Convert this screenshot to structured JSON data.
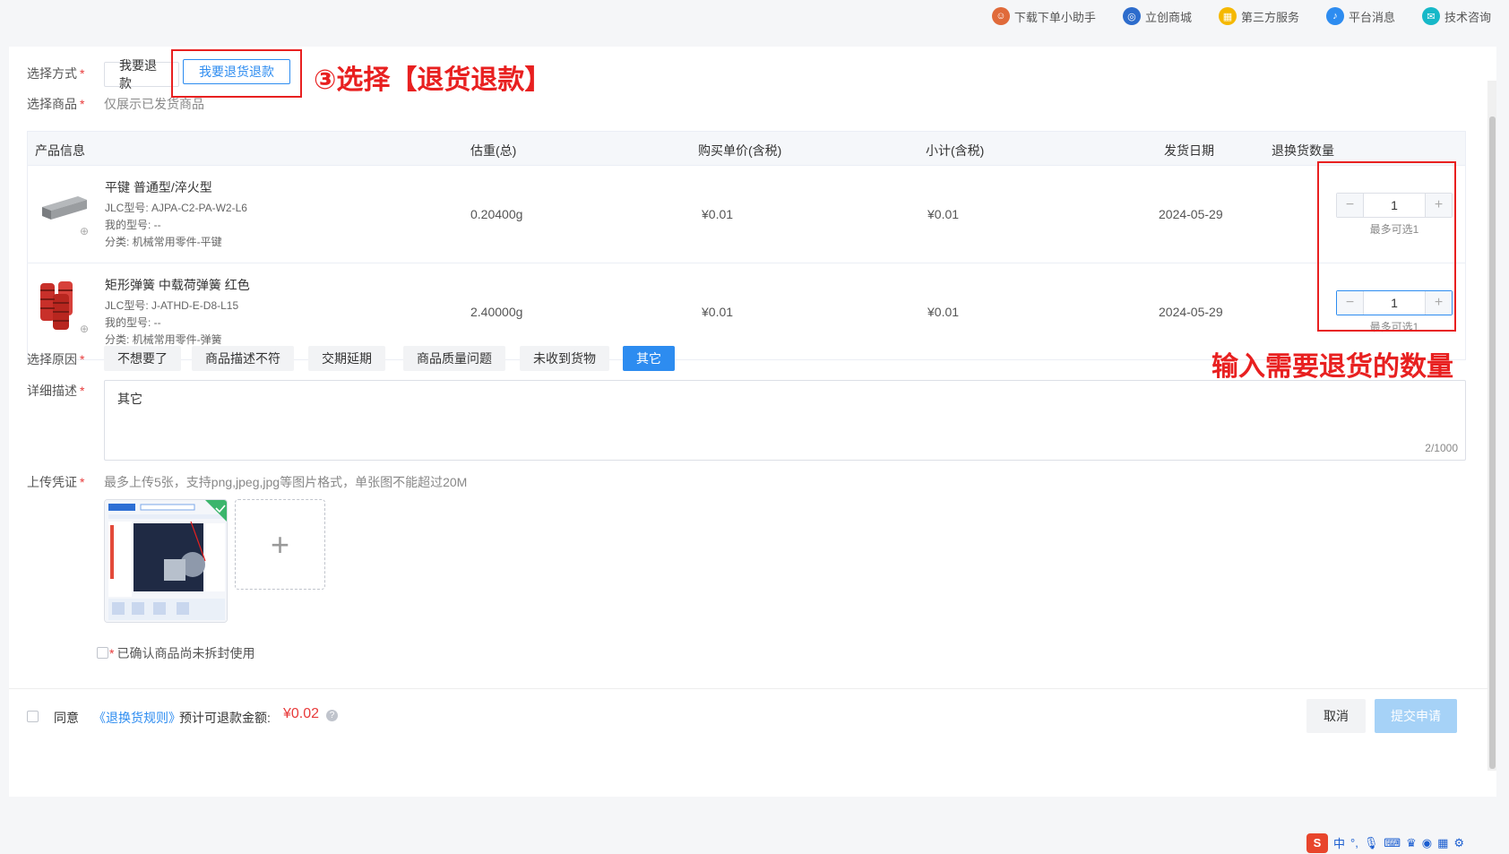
{
  "topbar": {
    "items": [
      {
        "label": "下载下单小助手",
        "icon": "assistant-avatar-icon",
        "color": "#e06a3a"
      },
      {
        "label": "立创商城",
        "icon": "mall-logo-icon",
        "color": "#2d6ccc"
      },
      {
        "label": "第三方服务",
        "icon": "grid-apps-icon",
        "color": "#f5b800"
      },
      {
        "label": "平台消息",
        "icon": "bell-icon",
        "color": "#2d8cf0"
      },
      {
        "label": "技术咨询",
        "icon": "chat-bubble-icon",
        "color": "#16b8c8"
      }
    ]
  },
  "form": {
    "method_label": "选择方式",
    "method_options": [
      "我要退款",
      "我要退货退款"
    ],
    "method_selected": "我要退货退款",
    "annotation_method": "③选择【退货退款】",
    "goods_label": "选择商品",
    "goods_hint": "仅展示已发货商品",
    "reason_label": "选择原因",
    "reasons": [
      "不想要了",
      "商品描述不符",
      "交期延期",
      "商品质量问题",
      "未收到货物",
      "其它"
    ],
    "reason_selected": "其它",
    "desc_label": "详细描述",
    "desc_value": "其它",
    "desc_counter": "2/1000",
    "upload_label": "上传凭证",
    "upload_hint": "最多上传5张，支持png,jpeg,jpg等图片格式，单张图不能超过20M",
    "upload_add": "+",
    "confirm_req": "*",
    "confirm_text": "已确认商品尚未拆封使用",
    "required_mark": "*"
  },
  "table": {
    "headers": {
      "product": "产品信息",
      "weight": "估重(总)",
      "unit_price": "购买单价(含税)",
      "subtotal": "小计(含税)",
      "ship_date": "发货日期",
      "qty": "退换货数量"
    },
    "rows": [
      {
        "name": "平键 普通型/淬火型",
        "jlc": "JLC型号: AJPA-C2-PA-W2-L6",
        "my_model": "我的型号: --",
        "category": "分类: 机械常用零件-平键",
        "weight": "0.20400g",
        "unit_price": "¥0.01",
        "subtotal": "¥0.01",
        "ship_date": "2024-05-29",
        "qty": "1",
        "max_hint": "最多可选1"
      },
      {
        "name": "矩形弹簧 中载荷弹簧 红色",
        "jlc": "JLC型号: J-ATHD-E-D8-L15",
        "my_model": "我的型号: --",
        "category": "分类: 机械常用零件-弹簧",
        "weight": "2.40000g",
        "unit_price": "¥0.01",
        "subtotal": "¥0.01",
        "ship_date": "2024-05-29",
        "qty": "1",
        "max_hint": "最多可选1"
      }
    ],
    "annotation_qty": "输入需要退货的数量",
    "stepper_minus": "−",
    "stepper_plus": "+"
  },
  "footer": {
    "agree": "同意",
    "rules_link": "《退换货规则》",
    "refund_label": "预计可退款金额:",
    "refund_amount": "¥0.02",
    "cancel": "取消",
    "submit": "提交申请"
  },
  "ime": {
    "logo": "S",
    "lang": "中",
    "punct": "°,"
  },
  "colors": {
    "primary": "#2d8cf0",
    "annotation_red": "#e82020",
    "submit_disabled": "#a6d2f7",
    "price_red": "#e83a3a"
  }
}
